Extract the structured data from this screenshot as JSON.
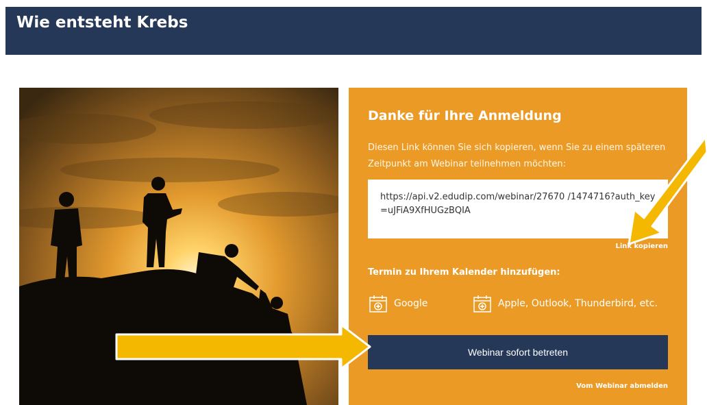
{
  "header": {
    "title": "Wie entsteht Krebs"
  },
  "panel": {
    "title": "Danke für Ihre Anmeldung",
    "description": "Diesen Link können Sie sich kopieren, wenn Sie zu einem späteren Zeitpunkt am Webinar teilnehmen möchten:",
    "link_url": "https://api.v2.edudip.com/webinar/27670 /1474716?auth_key=uJFiA9XfHUGzBQIA",
    "copy_label": "Link kopieren",
    "calendar_title": "Termin zu Ihrem Kalender hinzufügen:",
    "calendar_options": [
      {
        "label": "Google",
        "icon": "calendar-add-icon"
      },
      {
        "label": "Apple, Outlook, Thunderbird, etc.",
        "icon": "calendar-add-icon"
      }
    ],
    "join_label": "Webinar sofort betreten",
    "unsubscribe_label": "Vom Webinar abmelden"
  },
  "colors": {
    "header_bg": "#253858",
    "panel_bg": "#ec9a26",
    "button_bg": "#253858",
    "annotation_arrow": "#f5b800"
  },
  "image": {
    "description_icon": "hikers-silhouette-sunset-photo"
  }
}
